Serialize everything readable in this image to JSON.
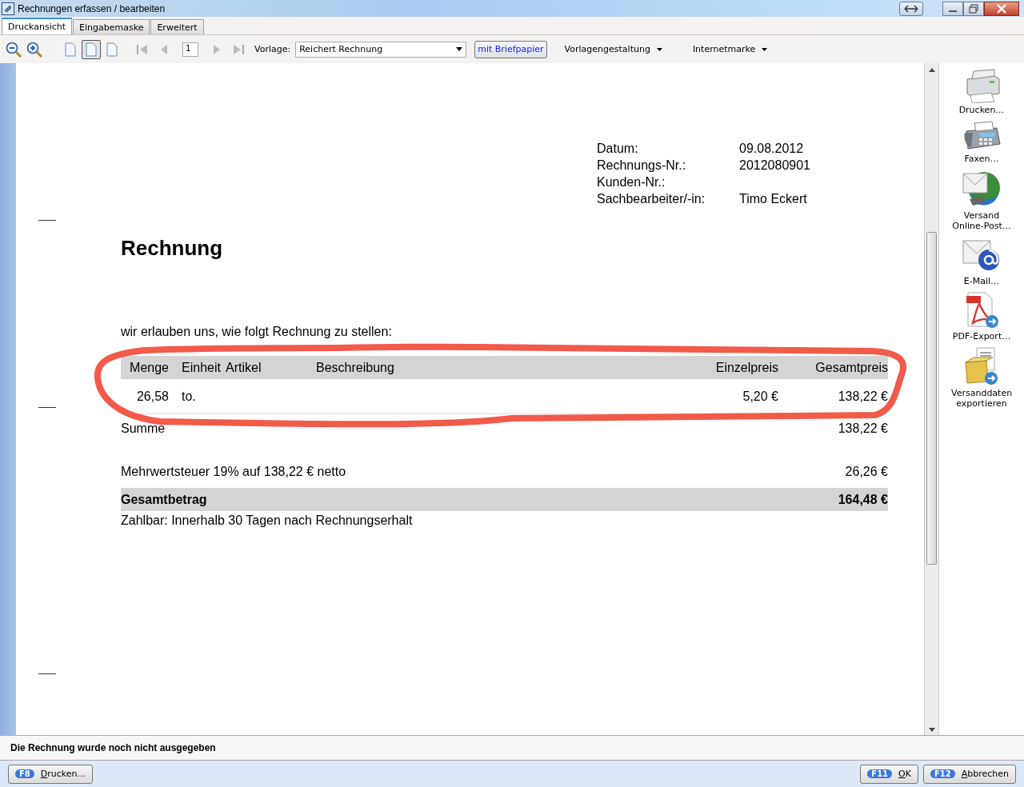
{
  "window": {
    "title": "Rechnungen erfassen / bearbeiten"
  },
  "tabs": [
    {
      "label": "Druckansicht",
      "selected": true
    },
    {
      "label": "Eingabemaske",
      "selected": false
    },
    {
      "label": "Erweitert",
      "selected": false
    }
  ],
  "toolbar": {
    "page_views": [
      {
        "selected": false
      },
      {
        "selected": true
      },
      {
        "selected": false
      }
    ],
    "page_number": "1",
    "template_label": "Vorlage:",
    "template_value": "Reichert Rechnung",
    "letterhead_button": {
      "label": "mit Briefpapier",
      "on": true
    },
    "menus": [
      "Vorlagengestaltung",
      "Internetmarke"
    ]
  },
  "document": {
    "meta": [
      {
        "label": "Datum:",
        "value": "09.08.2012"
      },
      {
        "label": "Rechnungs-Nr.:",
        "value": "2012080901"
      },
      {
        "label": "Kunden-Nr.:"
      },
      {
        "label": "Sachbearbeiter/-in:",
        "value": "Timo Eckert"
      }
    ],
    "heading": "Rechnung",
    "intro": "wir erlauben uns, wie folgt Rechnung zu stellen:",
    "table": {
      "columns": [
        {
          "label": "Menge",
          "kind": "number"
        },
        {
          "label": "Einheit",
          "kind": "text"
        },
        {
          "label": "Artikel",
          "kind": "text"
        },
        {
          "label": "Beschreibung",
          "kind": "text"
        },
        {
          "label": "Einzelpreis",
          "kind": "number"
        },
        {
          "label": "Gesamtpreis",
          "kind": "number"
        }
      ],
      "rows": [
        {
          "quantity": "26,58",
          "unit": "to.",
          "unit_price": "5,20 €",
          "total_price": "138,22 €"
        }
      ]
    },
    "sum": {
      "label": "Summe",
      "value": "138,22 €"
    },
    "vat": {
      "label": "Mehrwertsteuer 19% auf 138,22 € netto",
      "value": "26,26 €"
    },
    "total": {
      "label": "Gesamtbetrag",
      "value": "164,48 €"
    },
    "payment": "Zahlbar: Innerhalb 30 Tagen nach Rechnungserhalt"
  },
  "actions": [
    {
      "kind": "printer",
      "label": "Drucken…"
    },
    {
      "kind": "fax",
      "label": "Faxen…"
    },
    {
      "kind": "post",
      "label": "Versand Online-Post…"
    },
    {
      "kind": "email",
      "label": "E-Mail…"
    },
    {
      "kind": "pdf",
      "label": "PDF-Export…"
    },
    {
      "kind": "export",
      "label": "Versanddaten exportieren"
    }
  ],
  "status_bar": "Die Rechnung wurde noch nicht ausgegeben",
  "buttons": [
    {
      "key": "F8",
      "label": "Drucken..."
    },
    {
      "key": "F11",
      "label": "OK"
    },
    {
      "key": "F12",
      "label": "Abbrechen"
    }
  ]
}
